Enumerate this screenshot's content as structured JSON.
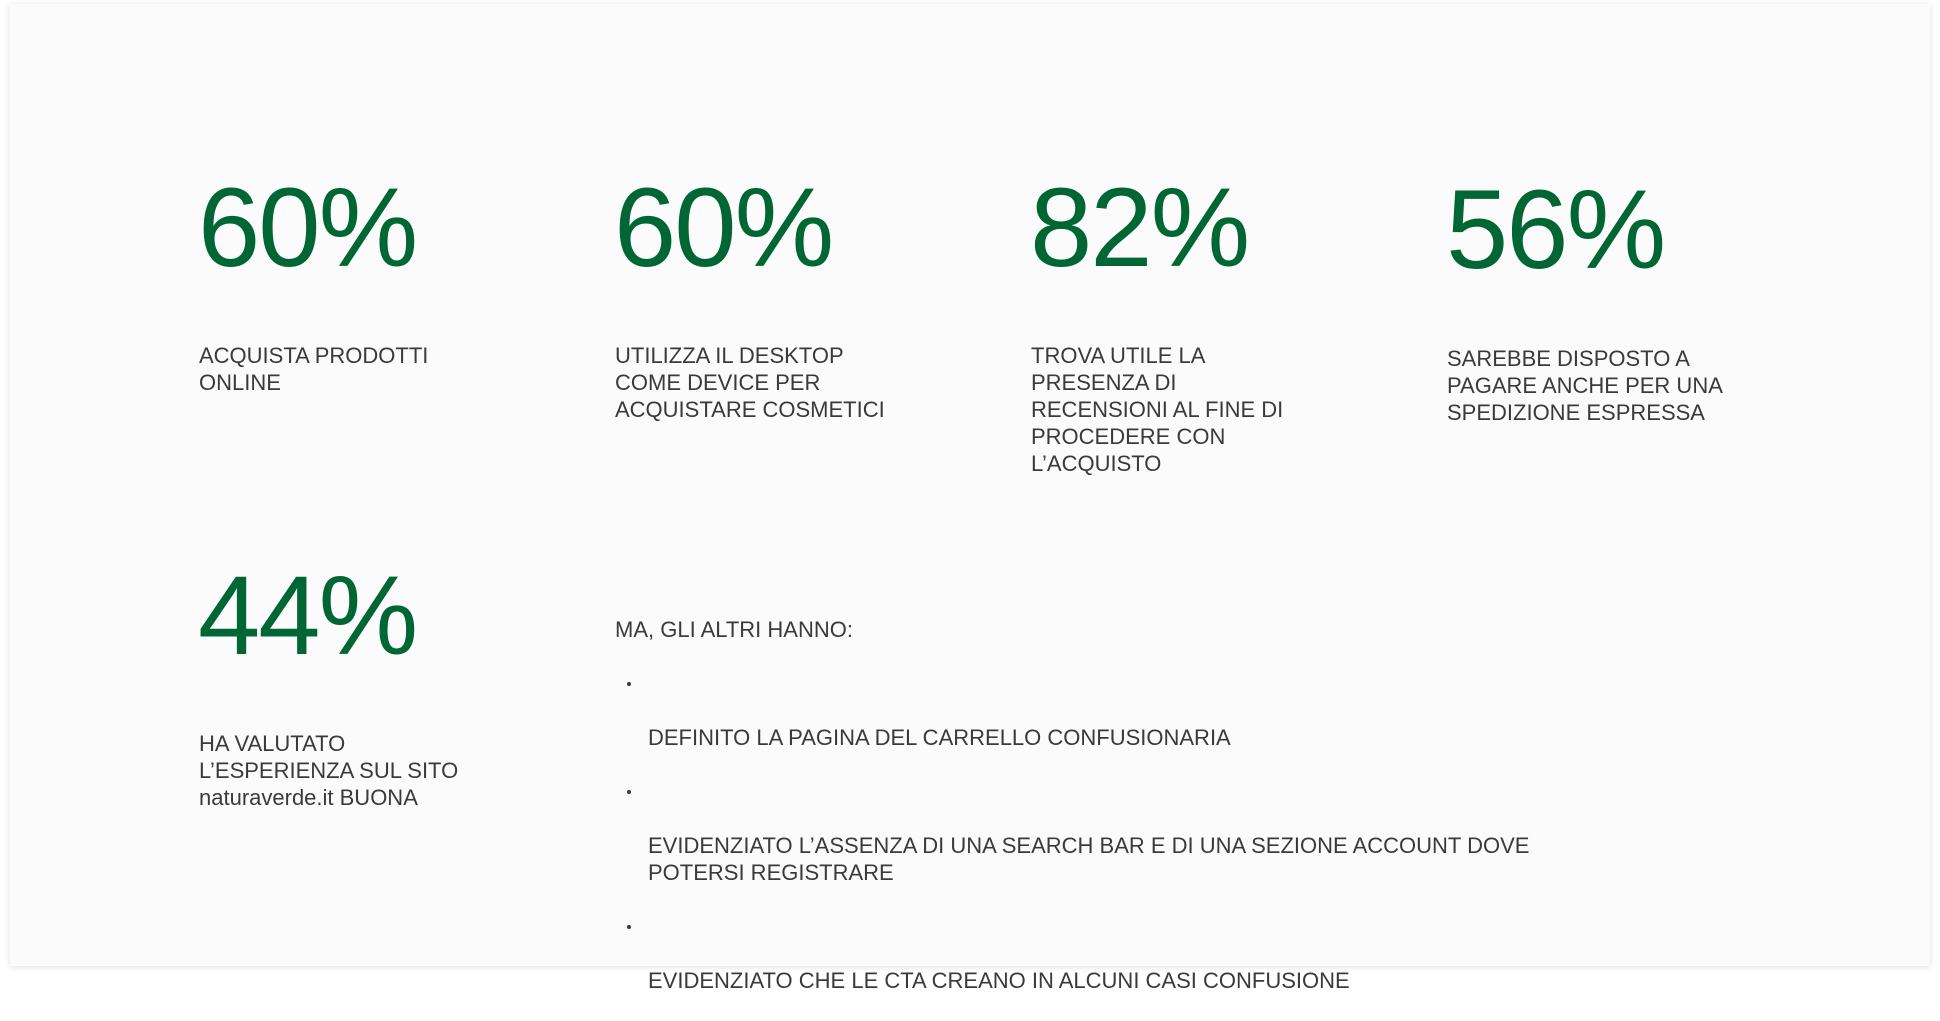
{
  "colors": {
    "accent": "#006633",
    "text": "#3a3a3a",
    "background": "#fbfbfb"
  },
  "stats": [
    {
      "value": "60%",
      "label": "ACQUISTA PRODOTTI\nONLINE"
    },
    {
      "value": "60%",
      "label": "UTILIZZA IL DESKTOP\nCOME DEVICE PER\nACQUISTARE COSMETICI"
    },
    {
      "value": "82%",
      "label": "TROVA UTILE LA\nPRESENZA DI\nRECENSIONI AL FINE DI\nPROCEDERE CON\nL’ACQUISTO"
    },
    {
      "value": "56%",
      "label": "SAREBBE DISPOSTO A\nPAGARE ANCHE PER UNA\nSPEDIZIONE ESPRESSA"
    },
    {
      "value": "44%",
      "label": "HA VALUTATO\nL’ESPERIENZA SUL SITO\nnaturaverde.it BUONA"
    }
  ],
  "others": {
    "title": "MA, GLI ALTRI HANNO:",
    "items": [
      "DEFINITO LA PAGINA DEL CARRELLO CONFUSIONARIA",
      "EVIDENZIATO L’ASSENZA DI UNA SEARCH BAR  E DI UNA SEZIONE ACCOUNT DOVE\nPOTERSI REGISTRARE",
      "EVIDENZIATO CHE LE CTA CREANO IN ALCUNI CASI CONFUSIONE"
    ]
  }
}
